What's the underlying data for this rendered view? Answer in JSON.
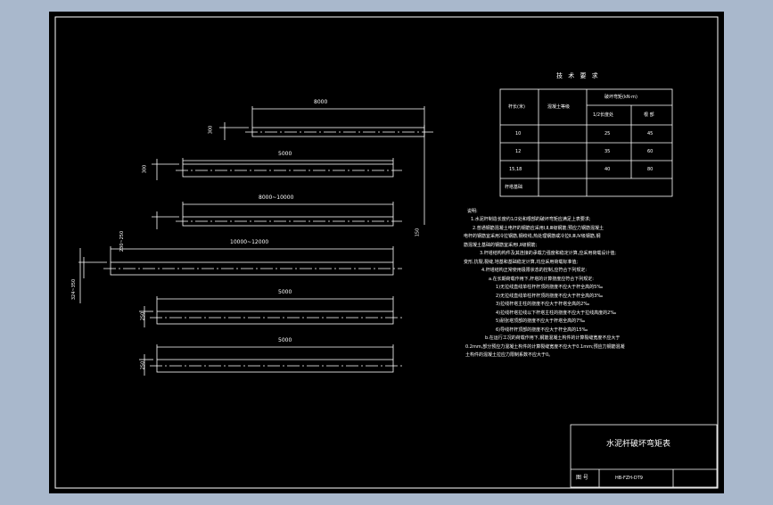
{
  "drawing": {
    "background_color": "#a9b8cc",
    "sheet_color": "#000000",
    "line_color": "#ffffff"
  },
  "poles": [
    {
      "length_label": "8000",
      "diameter_label": "300"
    },
    {
      "length_label": "5000",
      "diameter_label": "300"
    },
    {
      "length_label": "8000~10000",
      "diameter_label": "150"
    },
    {
      "length_label": "10000~12000",
      "diameter_label": "230~250"
    },
    {
      "length_label": "5000",
      "diameter_label": "250"
    },
    {
      "length_label": "5000",
      "diameter_label": "250"
    }
  ],
  "left_dim_label": "324~350",
  "tech": {
    "title": "技 术 要 求",
    "header_pole_length": "杆长(米)",
    "header_grade": "混凝土等级",
    "header_moment": "破坏弯矩(kN·m)",
    "header_half": "1/2长度处",
    "header_root": "根 部",
    "rows": [
      {
        "length": "10",
        "grade": "",
        "half": "25",
        "root": "45"
      },
      {
        "length": "12",
        "grade": "",
        "half": "35",
        "root": "60"
      },
      {
        "length": "15,18",
        "grade": "",
        "half": "40",
        "root": "80"
      },
      {
        "length": "杆塔基础",
        "grade": "",
        "half": "",
        "root": ""
      }
    ]
  },
  "notes": {
    "heading": "说明:",
    "lines": [
      "1.水泥杆制造长度约1/2处和根部的破坏弯矩应满足上表要求;",
      "2.普通钢筋混凝土电杆的钢筋应采用Ⅰ,Ⅱ,Ⅲ级钢筋;预应力钢筋混凝土",
      "电杆的钢筋宜采用冷拉钢筋,钢绞线,热处理钢筋或冷拉Ⅱ,Ⅲ,Ⅳ级钢筋,钢",
      "筋混凝土基础的钢筋宜采用Ⅰ,Ⅱ级钢筋;",
      "3.杆塔结构构件及其连接的承载力强度和稳定计算,应采用荷载设计值;",
      "变形,抗裂,裂缝,地基和基础稳定计算,均应采用荷载标准值;",
      "4.杆塔结构正常使用极限状态的控制,应符合下列规定:",
      "a.在长期荷载作用下,杆塔的计算挠度应符合下列规定:",
      "1)无拉线直线单柱杆杆顶的挠度不应大于杆全高的5‰",
      "2)无拉线直线单柱杆杆顶的挠度不应大于杆全高的3‰",
      "3)拉线杆塔主柱的挠度不应大于杆塔全高的2‰",
      "4)拉线杆塔拉线以下杆塔主柱的挠度不应大于拉线高度的2‰",
      "5)耐张塔顶部的挠度不应大于杆塔全高的7‰",
      "6)导线杆杆顶部的挠度不应大于杆全高的15‰",
      "b.在运行工况的荷载作用下,钢筋混凝土构件的计算裂缝宽度不应大于",
      "0.2mm,部分预应力混凝土构件的计算裂缝宽度不应大于0.1mm;预应力钢筋混凝",
      "土构件的混凝土拉应力限制系数不应大于0。"
    ]
  },
  "title_block": {
    "title": "水泥杆破坏弯矩表",
    "drawing_no_label": "图 号",
    "drawing_no": "HB-FZH-DT9"
  }
}
